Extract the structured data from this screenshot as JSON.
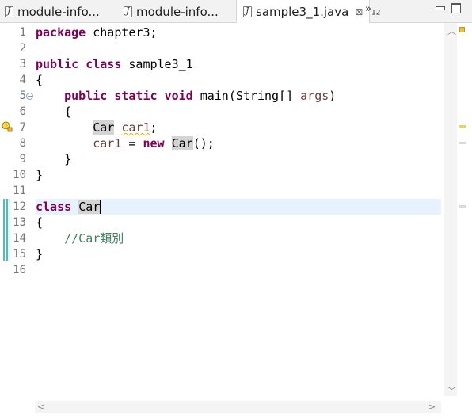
{
  "tabs": [
    {
      "label": "module-info...",
      "active": false
    },
    {
      "label": "module-info...",
      "active": false
    },
    {
      "label": "sample3_1.java",
      "active": true,
      "close": "⊠"
    }
  ],
  "overflow": {
    "symbol": "»",
    "count": "12"
  },
  "line_numbers": [
    "1",
    "2",
    "3",
    "4",
    "5",
    "6",
    "7",
    "8",
    "9",
    "10",
    "11",
    "12",
    "13",
    "14",
    "15",
    "16"
  ],
  "code": {
    "l1_kw": "package",
    "l1_rest": " chapter3;",
    "l3_kw1": "public",
    "l3_kw2": "class",
    "l3_rest": " sample3_1",
    "l4": "{",
    "l5_kw1": "public",
    "l5_kw2": "static",
    "l5_kw3": "void",
    "l5_mid": " main(String[] ",
    "l5_var": "args",
    "l5_end": ")",
    "l6": "{",
    "l7_type": "Car",
    "l7_var": "car1",
    "l7_end": ";",
    "l8_var": "car1",
    "l8_mid": " = ",
    "l8_kw": "new",
    "l8_type": "Car",
    "l8_end": "();",
    "l9": "}",
    "l10": "}",
    "l12_kw": "class",
    "l12_type": "Car",
    "l13": "{",
    "l14_comment": "//Car類別",
    "l15": "}"
  },
  "colors": {
    "keyword": "#7f0055",
    "comment": "#3f7f5f",
    "variable": "#6a3e3e",
    "current_line": "#e8f2fe"
  },
  "icons": [
    "java-file-icon",
    "close-icon",
    "minimize-icon",
    "maximize-icon",
    "warning-icon",
    "fold-icon"
  ]
}
